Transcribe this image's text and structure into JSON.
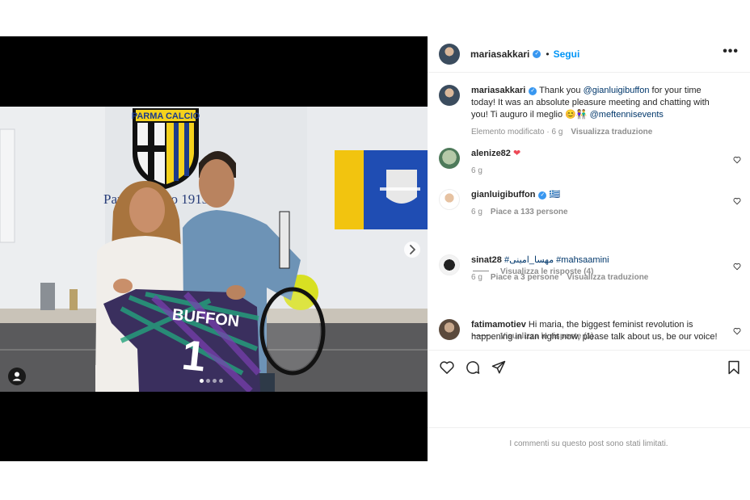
{
  "post": {
    "author": "mariasakkari",
    "follow_label": "Segui",
    "dot": "•",
    "more_label": "•••"
  },
  "caption": {
    "username": "mariasakkari",
    "text_1": "Thank you ",
    "mention_1": "@gianluigibuffon",
    "text_2": " for your time today! It was an absolute pleasure meeting and chatting with you! Ti auguro il meglio ",
    "emoji": "😊👫",
    "mention_2": "@meftennisevents",
    "edited": "Elemento modificato · 6 g",
    "translate": "Visualizza traduzione"
  },
  "comments": [
    {
      "username": "alenize82",
      "text": "❤",
      "time": "6 g",
      "likes": "",
      "translate": ""
    },
    {
      "username": "gianluigibuffon",
      "text": "🇬🇷",
      "time": "6 g",
      "likes": "Piace a 133 persone",
      "translate": "",
      "replies": "Visualizza le risposte (4)"
    },
    {
      "username": "sinat28",
      "text": "#مهسا_امینی #mahsaamini",
      "time": "6 g",
      "likes": "Piace a 3 persone",
      "translate": "Visualizza traduzione",
      "replies": "Visualizza le risposte (1)"
    },
    {
      "username": "fatimamotiev",
      "text": "Hi maria, the biggest feminist revolution is happening in iran right now, please talk about us, be our voice!",
      "time": "",
      "likes": "",
      "translate": ""
    }
  ],
  "footer": {
    "limited": "I commenti su questo post sono stati limitati."
  },
  "photo": {
    "sign_text": "PARMA CALCIO",
    "wall_text": "Parma Calcio 1913",
    "jersey_text": "BUFFON",
    "jersey_number": "1"
  },
  "carousel": {
    "current": 1,
    "total": 4
  },
  "colors": {
    "accent": "#0095f6",
    "verified": "#3897f0",
    "heart": "#ed4956",
    "link": "#00376b"
  },
  "icons": [
    "heart-icon",
    "comment-icon",
    "share-icon",
    "bookmark-icon",
    "verified-icon",
    "chevron-right-icon",
    "user-tag-icon"
  ]
}
